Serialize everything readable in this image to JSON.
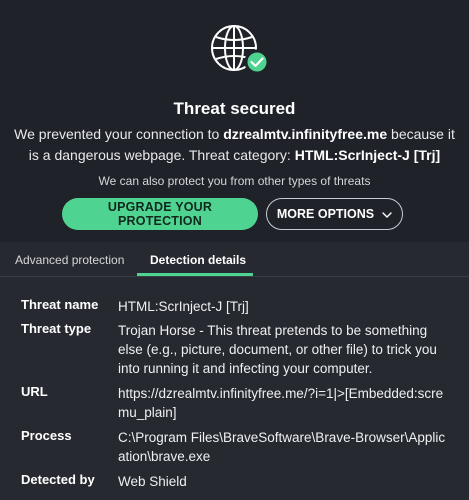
{
  "header": {
    "icon": "globe-shield-check-icon",
    "title": "Threat secured",
    "desc_prefix": "We prevented your connection to ",
    "desc_domain": "dzrealmtv.infinityfree.me",
    "desc_middle": " because it is a dangerous webpage. Threat category: ",
    "desc_category": "HTML:ScrInject-J [Trj]",
    "protect_text": "We can also protect you from other types of threats",
    "upgrade_label": "UPGRADE YOUR PROTECTION",
    "more_label": "MORE OPTIONS"
  },
  "tabs": {
    "advanced": "Advanced protection",
    "details": "Detection details"
  },
  "details": {
    "threat_name_key": "Threat name",
    "threat_name_val": "HTML:ScrInject-J [Trj]",
    "threat_type_key": "Threat type",
    "threat_type_val": "Trojan Horse - This threat pretends to be something else (e.g., picture, document, or other file) to trick you into running it and infecting your computer.",
    "url_key": "URL",
    "url_val": "https://dzrealmtv.infinityfree.me/?i=1|>[Embedded:scremu_plain]",
    "process_key": "Process",
    "process_val": "C:\\Program Files\\BraveSoftware\\Brave-Browser\\Application\\brave.exe",
    "detected_key": "Detected by",
    "detected_val": "Web Shield"
  },
  "colors": {
    "accent": "#4fd391",
    "background": "#26292f",
    "top_background": "#1f2228"
  }
}
